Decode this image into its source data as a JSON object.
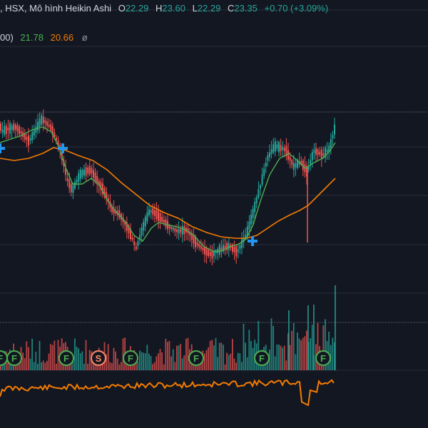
{
  "legend": {
    "prefix": ", HSX, Mô hình Heikin Ashi",
    "open_key": "O",
    "open": "22.29",
    "high_key": "H",
    "high": "23.60",
    "low_key": "L",
    "low": "22.29",
    "close_key": "C",
    "close": "23.35",
    "change": "+0.70 (+3.09%)"
  },
  "ma_legend": {
    "period_tail": "00)",
    "ma_short": "21.78",
    "ma_long": "20.66",
    "empty": "ø"
  },
  "markers": [
    {
      "label": "F",
      "kind": "foreign"
    },
    {
      "label": "F",
      "kind": "foreign"
    },
    {
      "label": "F",
      "kind": "foreign"
    },
    {
      "label": "S",
      "kind": "split"
    },
    {
      "label": "F",
      "kind": "foreign"
    },
    {
      "label": "F",
      "kind": "foreign"
    },
    {
      "label": "F",
      "kind": "foreign"
    },
    {
      "label": "F",
      "kind": "foreign"
    }
  ],
  "colors": {
    "background": "#131722",
    "up": "#26a69a",
    "down": "#ef5350",
    "ma_short": "#4caf50",
    "ma_long": "#f57c00",
    "cross_marker": "#2196f3",
    "marker_f": "#4caf50",
    "marker_s": "#ff8a65"
  },
  "icons": [
    "cross-signal-icon",
    "marker-f-icon",
    "marker-s-icon"
  ]
}
